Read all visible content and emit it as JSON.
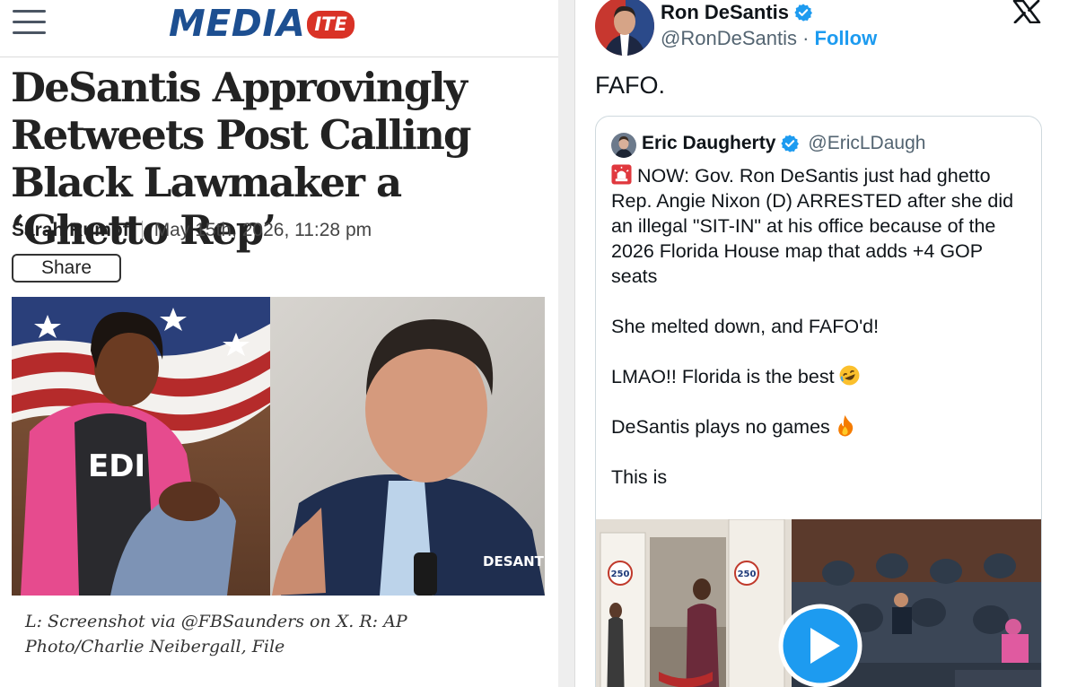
{
  "article": {
    "logo_word": "MEDIA",
    "logo_badge": "ITE",
    "headline": "DeSantis Approvingly Retweets Post Calling Black Lawmaker a ‘Ghetto Rep’",
    "author": "Sarah Rumpf",
    "date": "May 15th, 2026, 11:28 pm",
    "share_label": "Share",
    "photo_alt": "L: Angie Nixon; R: Ron DeSantis",
    "caption": "L: Screenshot via @FBSaunders on X. R: AP Photo/Charlie Neibergall, File",
    "jacket_text": "DESANT",
    "hoodie_text": "EDI"
  },
  "post": {
    "author_name": "Ron DeSantis",
    "author_handle": "@RonDeSantis",
    "separator": " · ",
    "follow_label": "Follow",
    "text": "FAFO.",
    "quoted": {
      "author_name": "Eric Daugherty",
      "author_handle": "@EricLDaugh",
      "paragraphs": [
        "NOW: Gov. Ron DeSantis just had ghetto Rep. Angie Nixon (D) ARRESTED after she did an illegal \"SIT-IN\" at his office because of the 2026 Florida House map that adds +4 GOP seats",
        "She melted down, and FAFO'd!",
        "LMAO!! Florida is the best",
        "DeSantis plays no games",
        "This is"
      ],
      "media_sign": "250"
    }
  },
  "colors": {
    "brand_blue": "#1d4f91",
    "brand_red": "#d93226",
    "x_blue": "#1d9bf0",
    "text_dark": "#0f1419",
    "text_gray": "#536471"
  },
  "icons": {
    "menu": "hamburger-icon",
    "verified": "verified-badge-icon",
    "x": "x-logo-icon",
    "siren": "siren-emoji",
    "laughing": "rofl-emoji",
    "fire": "fire-emoji",
    "play": "play-icon"
  }
}
